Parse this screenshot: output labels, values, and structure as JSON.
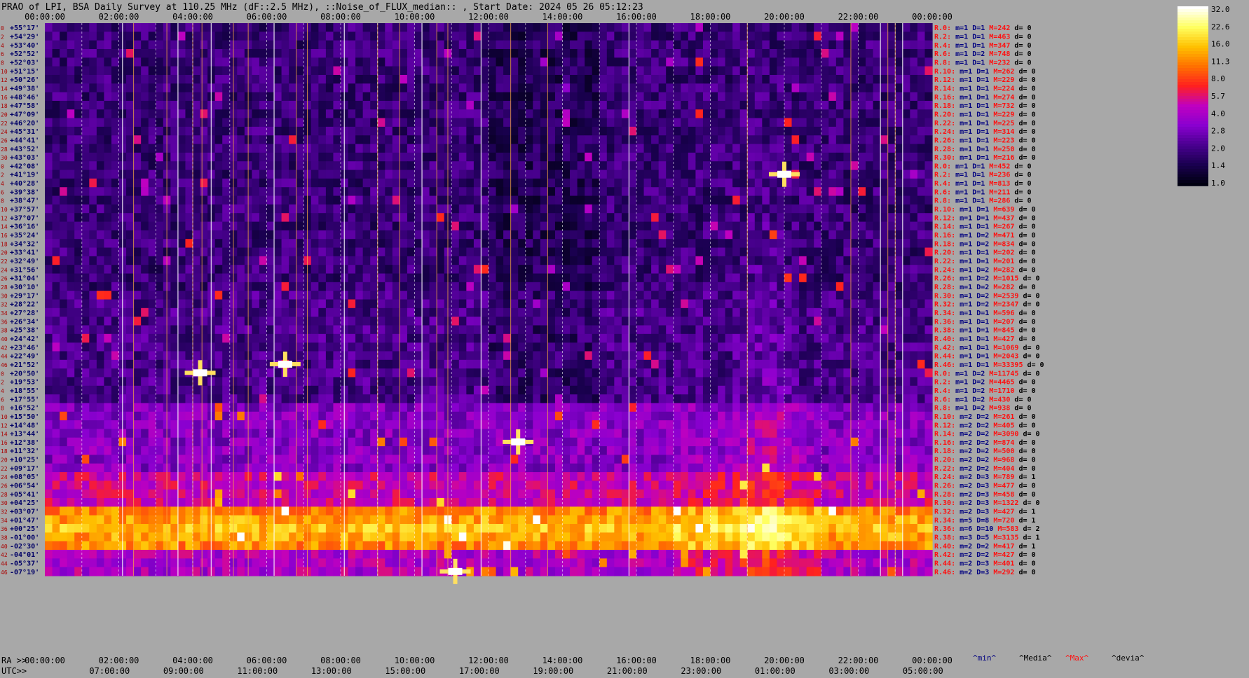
{
  "title": "PRAO of LPI, BSA Daily Survey at 110.25 MHz (dF::2.5 MHz), ::Noise_of_FLUX_median:: , Start Date: 2024 05 26 05:12:23",
  "chart_data": {
    "type": "heatmap",
    "top_ticks": [
      "00:00:00",
      "02:00:00",
      "04:00:00",
      "06:00:00",
      "08:00:00",
      "10:00:00",
      "12:00:00",
      "14:00:00",
      "16:00:00",
      "18:00:00",
      "20:00:00",
      "22:00:00",
      "00:00:00"
    ],
    "ra_ticks": [
      "00:00:00",
      "02:00:00",
      "04:00:00",
      "06:00:00",
      "08:00:00",
      "10:00:00",
      "12:00:00",
      "14:00:00",
      "16:00:00",
      "18:00:00",
      "20:00:00",
      "22:00:00",
      "00:00:00"
    ],
    "utc_ticks": [
      "07:00:00",
      "09:00:00",
      "11:00:00",
      "13:00:00",
      "15:00:00",
      "17:00:00",
      "19:00:00",
      "21:00:00",
      "23:00:00",
      "01:00:00",
      "03:00:00",
      "05:00:00"
    ],
    "ra_label": "RA >>",
    "utc_label": "UTC>>",
    "dec_labels": [
      "+55°17'",
      "+54°29'",
      "+53°40'",
      "+52°52'",
      "+52°03'",
      "+51°15'",
      "+50°26'",
      "+49°38'",
      "+48°46'",
      "+47°58'",
      "+47°09'",
      "+46°20'",
      "+45°31'",
      "+44°41'",
      "+43°52'",
      "+43°03'",
      "+42°08'",
      "+41°19'",
      "+40°28'",
      "+39°38'",
      "+38°47'",
      "+37°57'",
      "+37°07'",
      "+36°16'",
      "+35°24'",
      "+34°32'",
      "+33°41'",
      "+32°49'",
      "+31°56'",
      "+31°04'",
      "+30°10'",
      "+29°17'",
      "+28°22'",
      "+27°28'",
      "+26°34'",
      "+25°38'",
      "+24°42'",
      "+23°46'",
      "+22°49'",
      "+21°52'",
      "+20°50'",
      "+19°53'",
      "+18°55'",
      "+17°55'",
      "+16°52'",
      "+15°50'",
      "+14°48'",
      "+13°44'",
      "+12°38'",
      "+11°32'",
      "+10°25'",
      "+09°17'",
      "+08°05'",
      "+06°54'",
      "+05°41'",
      "+04°25'",
      "+03°07'",
      "+01°47'",
      "+00°25'",
      "-01°00'",
      "-02°30'",
      "-04°01'",
      "-05°37'",
      "-07°19'"
    ],
    "row_index": [
      "0",
      "2",
      "4",
      "6",
      "8",
      "10",
      "12",
      "14",
      "16",
      "18",
      "20",
      "22",
      "24",
      "26",
      "28",
      "30",
      "0",
      "2",
      "4",
      "6",
      "8",
      "10",
      "12",
      "14",
      "16",
      "18",
      "20",
      "22",
      "24",
      "26",
      "28",
      "30",
      "32",
      "34",
      "36",
      "38",
      "40",
      "42",
      "44",
      "46",
      "0",
      "2",
      "4",
      "6",
      "8",
      "10",
      "12",
      "14",
      "16",
      "18",
      "20",
      "22",
      "24",
      "26",
      "28",
      "30",
      "32",
      "34",
      "36",
      "38",
      "40",
      "42",
      "44",
      "46"
    ],
    "channel_stats": [
      [
        "R.0:",
        "m=1",
        "D=1",
        "M=242",
        "d= 0"
      ],
      [
        "R.2:",
        "m=1",
        "D=1",
        "M=463",
        "d= 0"
      ],
      [
        "R.4:",
        "m=1",
        "D=1",
        "M=347",
        "d= 0"
      ],
      [
        "R.6:",
        "m=1",
        "D=2",
        "M=748",
        "d= 0"
      ],
      [
        "R.8:",
        "m=1",
        "D=1",
        "M=232",
        "d= 0"
      ],
      [
        "R.10:",
        "m=1",
        "D=1",
        "M=262",
        "d= 0"
      ],
      [
        "R.12:",
        "m=1",
        "D=1",
        "M=229",
        "d= 0"
      ],
      [
        "R.14:",
        "m=1",
        "D=1",
        "M=224",
        "d= 0"
      ],
      [
        "R.16:",
        "m=1",
        "D=1",
        "M=274",
        "d= 0"
      ],
      [
        "R.18:",
        "m=1",
        "D=1",
        "M=732",
        "d= 0"
      ],
      [
        "R.20:",
        "m=1",
        "D=1",
        "M=229",
        "d= 0"
      ],
      [
        "R.22:",
        "m=1",
        "D=1",
        "M=225",
        "d= 0"
      ],
      [
        "R.24:",
        "m=1",
        "D=1",
        "M=314",
        "d= 0"
      ],
      [
        "R.26:",
        "m=1",
        "D=1",
        "M=223",
        "d= 0"
      ],
      [
        "R.28:",
        "m=1",
        "D=1",
        "M=250",
        "d= 0"
      ],
      [
        "R.30:",
        "m=1",
        "D=1",
        "M=216",
        "d= 0"
      ],
      [
        "R.0:",
        "m=1",
        "D=1",
        "M=452",
        "d= 0"
      ],
      [
        "R.2:",
        "m=1",
        "D=1",
        "M=236",
        "d= 0"
      ],
      [
        "R.4:",
        "m=1",
        "D=1",
        "M=813",
        "d= 0"
      ],
      [
        "R.6:",
        "m=1",
        "D=1",
        "M=211",
        "d= 0"
      ],
      [
        "R.8:",
        "m=1",
        "D=1",
        "M=286",
        "d= 0"
      ],
      [
        "R.10:",
        "m=1",
        "D=1",
        "M=639",
        "d= 0"
      ],
      [
        "R.12:",
        "m=1",
        "D=1",
        "M=437",
        "d= 0"
      ],
      [
        "R.14:",
        "m=1",
        "D=1",
        "M=267",
        "d= 0"
      ],
      [
        "R.16:",
        "m=1",
        "D=2",
        "M=471",
        "d= 0"
      ],
      [
        "R.18:",
        "m=1",
        "D=2",
        "M=834",
        "d= 0"
      ],
      [
        "R.20:",
        "m=1",
        "D=1",
        "M=202",
        "d= 0"
      ],
      [
        "R.22:",
        "m=1",
        "D=1",
        "M=201",
        "d= 0"
      ],
      [
        "R.24:",
        "m=1",
        "D=2",
        "M=282",
        "d= 0"
      ],
      [
        "R.26:",
        "m=1",
        "D=2",
        "M=1015",
        "d= 0"
      ],
      [
        "R.28:",
        "m=1",
        "D=2",
        "M=282",
        "d= 0"
      ],
      [
        "R.30:",
        "m=1",
        "D=2",
        "M=2539",
        "d= 0"
      ],
      [
        "R.32:",
        "m=1",
        "D=2",
        "M=2347",
        "d= 0"
      ],
      [
        "R.34:",
        "m=1",
        "D=1",
        "M=596",
        "d= 0"
      ],
      [
        "R.36:",
        "m=1",
        "D=1",
        "M=207",
        "d= 0"
      ],
      [
        "R.38:",
        "m=1",
        "D=1",
        "M=845",
        "d= 0"
      ],
      [
        "R.40:",
        "m=1",
        "D=1",
        "M=427",
        "d= 0"
      ],
      [
        "R.42:",
        "m=1",
        "D=1",
        "M=1069",
        "d= 0"
      ],
      [
        "R.44:",
        "m=1",
        "D=1",
        "M=2043",
        "d= 0"
      ],
      [
        "R.46:",
        "m=1",
        "D=1",
        "M=33395",
        "d= 0"
      ],
      [
        "R.0:",
        "m=1",
        "D=2",
        "M=11745",
        "d= 0"
      ],
      [
        "R.2:",
        "m=1",
        "D=2",
        "M=4465",
        "d= 0"
      ],
      [
        "R.4:",
        "m=1",
        "D=2",
        "M=1710",
        "d= 0"
      ],
      [
        "R.6:",
        "m=1",
        "D=2",
        "M=430",
        "d= 0"
      ],
      [
        "R.8:",
        "m=1",
        "D=2",
        "M=938",
        "d= 0"
      ],
      [
        "R.10:",
        "m=2",
        "D=2",
        "M=261",
        "d= 0"
      ],
      [
        "R.12:",
        "m=2",
        "D=2",
        "M=405",
        "d= 0"
      ],
      [
        "R.14:",
        "m=2",
        "D=2",
        "M=3090",
        "d= 0"
      ],
      [
        "R.16:",
        "m=2",
        "D=2",
        "M=874",
        "d= 0"
      ],
      [
        "R.18:",
        "m=2",
        "D=2",
        "M=500",
        "d= 0"
      ],
      [
        "R.20:",
        "m=2",
        "D=2",
        "M=968",
        "d= 0"
      ],
      [
        "R.22:",
        "m=2",
        "D=2",
        "M=404",
        "d= 0"
      ],
      [
        "R.24:",
        "m=2",
        "D=3",
        "M=789",
        "d= 1"
      ],
      [
        "R.26:",
        "m=2",
        "D=3",
        "M=477",
        "d= 0"
      ],
      [
        "R.28:",
        "m=2",
        "D=3",
        "M=458",
        "d= 0"
      ],
      [
        "R.30:",
        "m=2",
        "D=3",
        "M=1322",
        "d= 0"
      ],
      [
        "R.32:",
        "m=2",
        "D=3",
        "M=427",
        "d= 1"
      ],
      [
        "R.34:",
        "m=5",
        "D=8",
        "M=720",
        "d= 1"
      ],
      [
        "R.36:",
        "m=6",
        "D=10",
        "M=583",
        "d= 2"
      ],
      [
        "R.38:",
        "m=3",
        "D=5",
        "M=3135",
        "d= 1"
      ],
      [
        "R.40:",
        "m=2",
        "D=2",
        "M=417",
        "d= 1"
      ],
      [
        "R.42:",
        "m=2",
        "D=2",
        "M=427",
        "d= 0"
      ],
      [
        "R.44:",
        "m=2",
        "D=3",
        "M=401",
        "d= 0"
      ],
      [
        "R.46:",
        "m=2",
        "D=3",
        "M=292",
        "d= 0"
      ]
    ],
    "legend_keys": [
      "^min^",
      "^Media^",
      "^Max^",
      "^devia^"
    ],
    "colorbar_ticks": [
      "32.0",
      "22.6",
      "16.0",
      "11.3",
      "8.0",
      "5.7",
      "4.0",
      "2.8",
      "2.0",
      "1.4",
      "1.0"
    ],
    "colorbar_range": [
      1.0,
      32.0
    ],
    "colormap": [
      "#000010",
      "#1a0050",
      "#4a0090",
      "#8a00d0",
      "#c000c0",
      "#ff2020",
      "#ff7000",
      "#ffc000",
      "#ffff60",
      "#ffffff"
    ],
    "x_range_hours": [
      0,
      24
    ],
    "features": {
      "equatorial_band_dec_rows": [
        56,
        60
      ],
      "bright_sources": [
        {
          "ra_h": 4.2,
          "row": 40
        },
        {
          "ra_h": 20.0,
          "row": 17
        },
        {
          "ra_h": 6.5,
          "row": 39
        },
        {
          "ra_h": 12.8,
          "row": 48
        },
        {
          "ra_h": 11.1,
          "row": 63
        }
      ]
    }
  }
}
